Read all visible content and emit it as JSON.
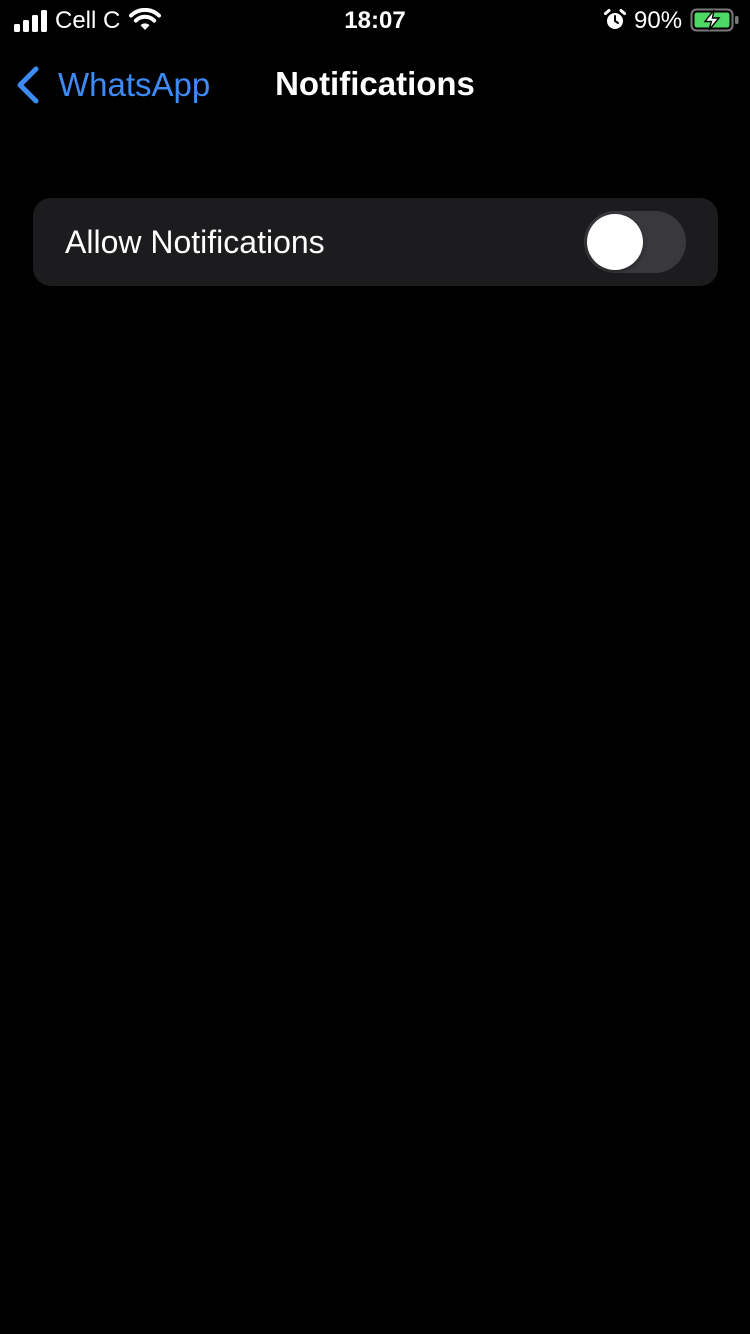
{
  "status_bar": {
    "carrier": "Cell C",
    "time": "18:07",
    "battery_percent": "90%",
    "icons": [
      "signal-icon",
      "wifi-icon",
      "alarm-icon",
      "battery-charging-icon"
    ]
  },
  "nav": {
    "back_label": "WhatsApp",
    "title": "Notifications"
  },
  "settings": {
    "allow_notifications": {
      "label": "Allow Notifications",
      "enabled": false
    }
  },
  "colors": {
    "background": "#000000",
    "accent": "#3d8bf7",
    "group_background": "#1c1c1e",
    "toggle_off": "#39393d",
    "battery_green": "#4cd964"
  }
}
